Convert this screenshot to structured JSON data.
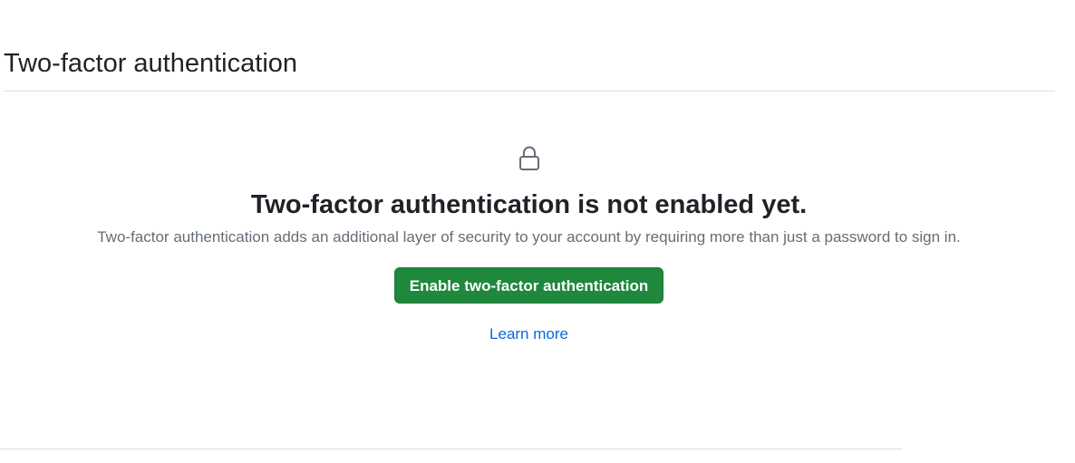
{
  "header": {
    "title": "Two-factor authentication"
  },
  "blankslate": {
    "icon": "lock-icon",
    "heading": "Two-factor authentication is not enabled yet.",
    "description": "Two-factor authentication adds an additional layer of security to your account by requiring more than just a password to sign in.",
    "enable_button_label": "Enable two-factor authentication",
    "learn_more_label": "Learn more"
  },
  "colors": {
    "primary_button": "#1f883d",
    "link": "#0969da",
    "muted_text": "#656d76",
    "divider": "#d8dee4"
  }
}
